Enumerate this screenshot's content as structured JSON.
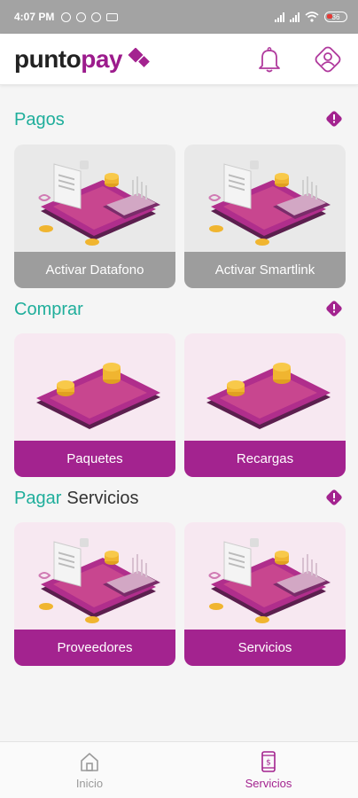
{
  "status_bar": {
    "time": "4:07 PM",
    "battery": "36"
  },
  "header": {
    "logo_part1": "punto",
    "logo_part2": "pay"
  },
  "sections": [
    {
      "title_1": "Pagos",
      "title_2": "",
      "cards": [
        {
          "label": "Activar Datafono",
          "art": "phone-card-receipt"
        },
        {
          "label": "Activar Smartlink",
          "art": "phone-card-receipt"
        }
      ]
    },
    {
      "title_1": "Comprar",
      "title_2": "",
      "cards": [
        {
          "label": "Paquetes",
          "art": "phone-coins"
        },
        {
          "label": "Recargas",
          "art": "phone-coins"
        }
      ]
    },
    {
      "title_1": "Pagar",
      "title_2": "Servicios",
      "cards": [
        {
          "label": "Proveedores",
          "art": "phone-card-receipt"
        },
        {
          "label": "Servicios",
          "art": "phone-card-receipt"
        }
      ]
    }
  ],
  "bottom_nav": [
    {
      "label": "Inicio",
      "icon": "home-icon",
      "active": false
    },
    {
      "label": "Servicios",
      "icon": "phone-dollar-icon",
      "active": true
    }
  ],
  "colors": {
    "brand": "#a3238f",
    "teal": "#1fae9b",
    "grey_label": "#9d9d9d"
  }
}
